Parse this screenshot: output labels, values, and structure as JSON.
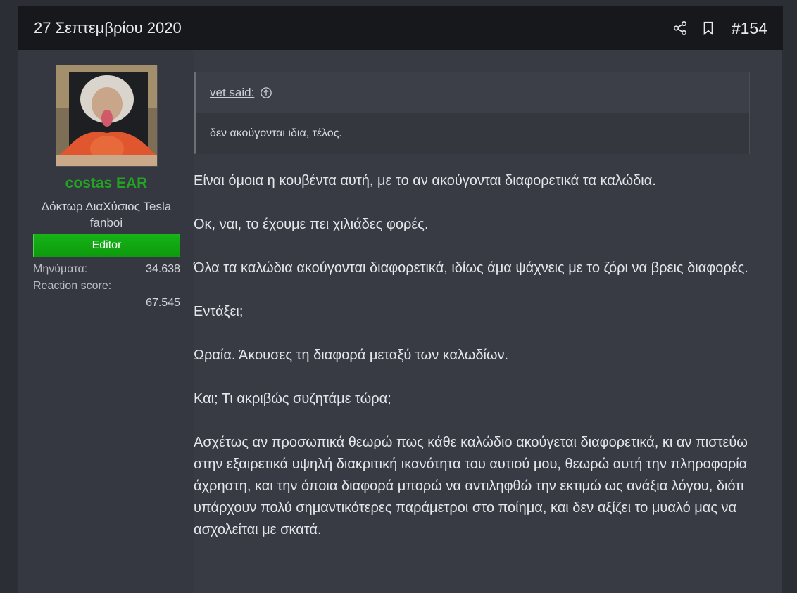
{
  "post": {
    "date": "27 Σεπτεμβρίου 2020",
    "number": "#154",
    "actions": [
      {
        "name": "share-icon"
      },
      {
        "name": "bookmark-icon"
      }
    ]
  },
  "user": {
    "name": "costas EAR",
    "name_color": "#22a322",
    "title": "Δόκτωρ ΔιαΧύσιος Tesla fanboi",
    "banner": "Editor",
    "banner_color": "#16b316",
    "stats": {
      "messages_label": "Μηνύματα:",
      "messages_value": "34.638",
      "reaction_label": "Reaction score:",
      "reaction_value": "67.545"
    }
  },
  "quote": {
    "author": "vet said:",
    "icon": "arrow-up-circle-icon",
    "text": "δεν ακούγονται ιδια, τέλος."
  },
  "message": {
    "paragraphs": [
      "Είναι όμοια η κουβέντα αυτή, με το αν ακούγονται διαφορετικά τα καλώδια.",
      "Οκ, ναι, το έχουμε πει χιλιάδες φορές.",
      "Όλα τα καλώδια ακούγονται διαφορετικά, ιδίως άμα ψάχνεις με το ζόρι να βρεις διαφορές.",
      "Εντάξει;",
      "Ωραία. Άκουσες τη διαφορά μεταξύ των καλωδίων.",
      "Και; Τι ακριβώς συζητάμε τώρα;",
      "Ασχέτως αν προσωπικά θεωρώ πως κάθε καλώδιο ακούγεται διαφορετικά, κι αν πιστεύω στην εξαιρετικά υψηλή διακριτική ικανότητα του αυτιού μου, θεωρώ αυτή την πληροφορία άχρηστη, και την όποια διαφορά μπορώ να αντιληφθώ την εκτιμώ ως ανάξια λόγου, διότι υπάρχουν πολύ σημαντικότερες παράμετροι στο ποίημα, και δεν αξίζει το μυαλό μας να ασχολείται με σκατά."
    ]
  }
}
